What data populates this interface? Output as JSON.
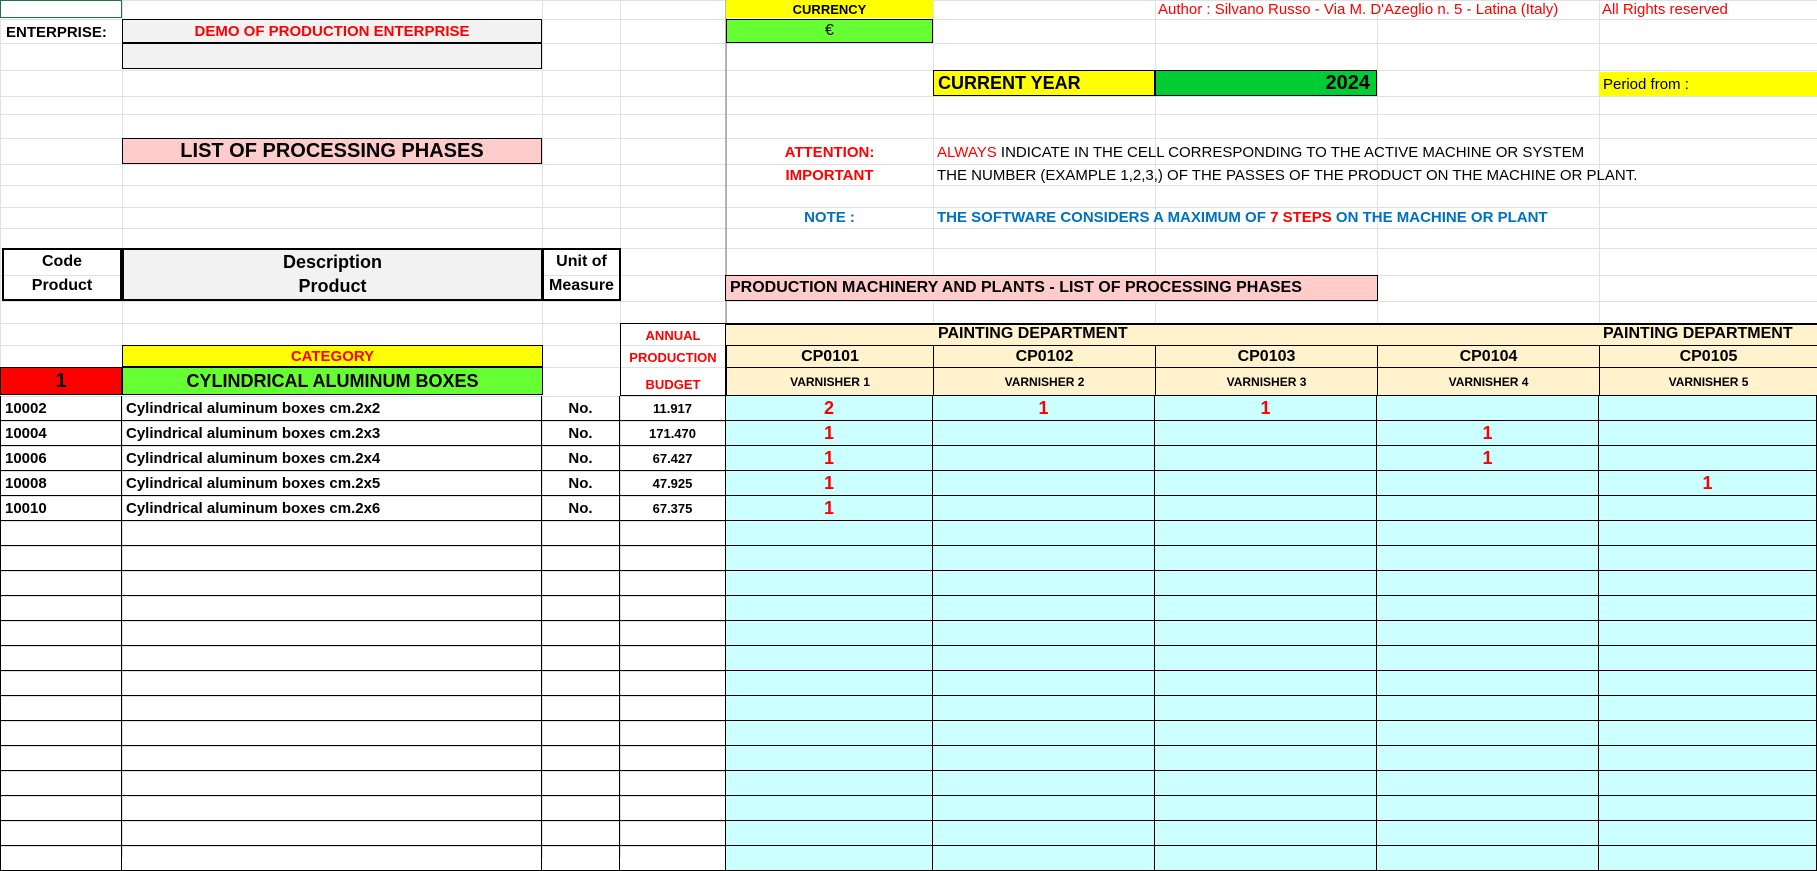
{
  "header": {
    "enterprise_label": "ENTERPRISE:",
    "enterprise_name": "DEMO OF PRODUCTION ENTERPRISE",
    "currency_label": "CURRENCY",
    "currency_symbol": "€",
    "author": "Author : Silvano Russo - Via M. D'Azeglio n. 5 - Latina (Italy)",
    "rights": "All Rights reserved",
    "current_year_label": "CURRENT YEAR",
    "current_year": "2024",
    "period_label": "Period from :"
  },
  "title": "LIST OF PROCESSING PHASES",
  "notices": {
    "attention_label": "ATTENTION:",
    "important_label": "IMPORTANT",
    "always_word": "ALWAYS",
    "line1_rest": " INDICATE IN THE CELL CORRESPONDING TO THE ACTIVE MACHINE OR SYSTEM",
    "line2": "THE NUMBER (EXAMPLE 1,2,3,) OF THE PASSES OF THE PRODUCT ON THE MACHINE OR PLANT.",
    "note_label": "NOTE :",
    "note_part1": "THE SOFTWARE CONSIDERS A MAXIMUM OF ",
    "note_highlight": "7 STEPS",
    "note_part2": " ON THE MACHINE OR PLANT"
  },
  "table_headers": {
    "code_line1": "Code",
    "code_line2": "Product",
    "desc_line1": "Description",
    "desc_line2": "Product",
    "unit_line1": "Unit of",
    "unit_line2": "Measure",
    "machinery_title": "PRODUCTION MACHINERY AND PLANTS - LIST OF PROCESSING PHASES",
    "annual": "ANNUAL",
    "production": "PRODUCTION",
    "budget": "BUDGET",
    "department_left": "PAINTING DEPARTMENT",
    "department_right": "PAINTING DEPARTMENT",
    "category_label": "CATEGORY",
    "category_number": "1",
    "category_name": "CYLINDRICAL ALUMINUM BOXES"
  },
  "machines": [
    {
      "code": "CP0101",
      "name": "VARNISHER 1"
    },
    {
      "code": "CP0102",
      "name": "VARNISHER 2"
    },
    {
      "code": "CP0103",
      "name": "VARNISHER 3"
    },
    {
      "code": "CP0104",
      "name": "VARNISHER 4"
    },
    {
      "code": "CP0105",
      "name": "VARNISHER 5"
    }
  ],
  "products": [
    {
      "code": "10002",
      "description": "Cylindrical aluminum boxes cm.2x2",
      "unit": "No.",
      "budget": "11.917",
      "passes": [
        "2",
        "1",
        "1",
        "",
        ""
      ]
    },
    {
      "code": "10004",
      "description": "Cylindrical aluminum boxes cm.2x3",
      "unit": "No.",
      "budget": "171.470",
      "passes": [
        "1",
        "",
        "",
        "1",
        ""
      ]
    },
    {
      "code": "10006",
      "description": "Cylindrical aluminum boxes cm.2x4",
      "unit": "No.",
      "budget": "67.427",
      "passes": [
        "1",
        "",
        "",
        "1",
        ""
      ]
    },
    {
      "code": "10008",
      "description": "Cylindrical aluminum boxes cm.2x5",
      "unit": "No.",
      "budget": "47.925",
      "passes": [
        "1",
        "",
        "",
        "",
        "1"
      ]
    },
    {
      "code": "10010",
      "description": "Cylindrical aluminum boxes cm.2x6",
      "unit": "No.",
      "budget": "67.375",
      "passes": [
        "1",
        "",
        "",
        "",
        ""
      ]
    }
  ],
  "empty_rows": 14,
  "colors": {
    "yellow": "#ffff00",
    "green": "#66ff33",
    "pink": "#ffcccc",
    "cyan": "#ccffff",
    "tan": "#fff2cc",
    "red": "#ff0000",
    "blue": "#0070c0",
    "grey_cell": "#f2f2f2"
  }
}
